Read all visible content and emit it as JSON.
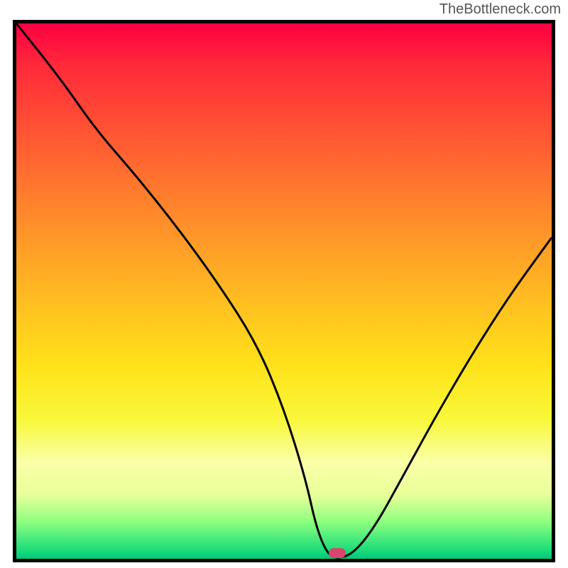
{
  "watermark": "TheBottleneck.com",
  "chart_data": {
    "type": "line",
    "title": "",
    "xlabel": "",
    "ylabel": "",
    "xlim": [
      0,
      100
    ],
    "ylim": [
      0,
      100
    ],
    "series": [
      {
        "name": "curve",
        "x": [
          0,
          8,
          15,
          22,
          30,
          38,
          45,
          50,
          54,
          56,
          58,
          60,
          63,
          67,
          72,
          78,
          85,
          92,
          100
        ],
        "values": [
          100,
          90,
          80,
          72,
          62,
          51,
          40,
          28,
          15,
          6,
          1,
          0,
          1,
          6,
          15,
          26,
          38,
          49,
          60
        ]
      }
    ],
    "marker": {
      "x": 60,
      "y": 0
    },
    "background": "heat-gradient"
  }
}
